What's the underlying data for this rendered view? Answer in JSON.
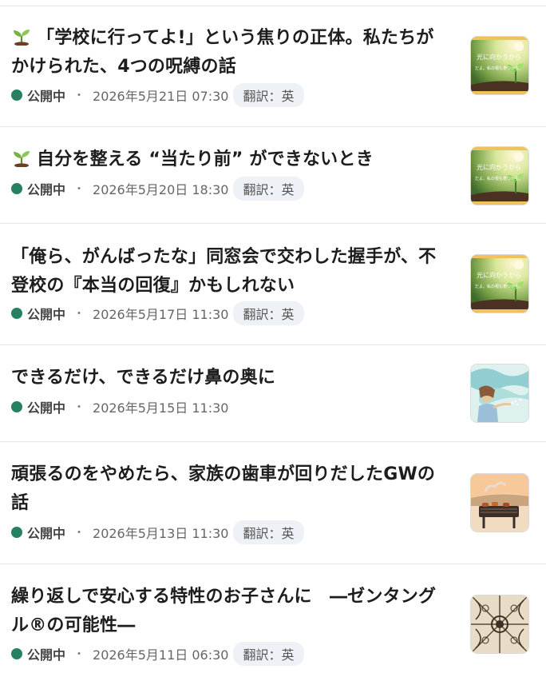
{
  "articles": [
    {
      "title": "「学校に行ってよ!」という焦りの正体。私たちがかけられた、4つの呪縛の話",
      "has_sprout": true,
      "status": "公開中",
      "separator": "・",
      "date": "2026年5月21日 07:30",
      "translation": "翻訳：英",
      "thumbnail": "sprout-sunlight-thumbnail"
    },
    {
      "title": "自分を整える “当たり前” ができないとき",
      "has_sprout": true,
      "status": "公開中",
      "separator": "・",
      "date": "2026年5月20日 18:30",
      "translation": "翻訳：英",
      "thumbnail": "sprout-sunlight-thumbnail"
    },
    {
      "title": "「俺ら、がんばったな」同窓会で交わした握手が、不登校の『本当の回復』かもしれない",
      "has_sprout": false,
      "status": "公開中",
      "separator": "・",
      "date": "2026年5月17日 11:30",
      "translation": "翻訳：英",
      "thumbnail": "sprout-sunlight-thumbnail"
    },
    {
      "title": "できるだけ、できるだけ鼻の奥に",
      "has_sprout": false,
      "status": "公開中",
      "separator": "・",
      "date": "2026年5月15日 11:30",
      "translation": "",
      "thumbnail": "woman-breathing-waves-thumbnail"
    },
    {
      "title": "頑張るのをやめたら、家族の歯車が回りだしたGWの話",
      "has_sprout": false,
      "status": "公開中",
      "separator": "・",
      "date": "2026年5月13日 11:30",
      "translation": "翻訳：英",
      "thumbnail": "bbq-grill-thumbnail"
    },
    {
      "title": "繰り返しで安心する特性のお子さんに　―ゼンタングル®の可能性―",
      "has_sprout": false,
      "status": "公開中",
      "separator": "・",
      "date": "2026年5月11日 06:30",
      "translation": "翻訳：英",
      "thumbnail": "zentangle-pattern-thumbnail"
    }
  ],
  "thumbnail_text": {
    "line1": "光に向かうから",
    "line2": "だよ。私の根も育つから。"
  },
  "colors": {
    "status_dot": "#258160",
    "badge_bg": "#eef2f6",
    "divider": "#e4e4e4"
  }
}
